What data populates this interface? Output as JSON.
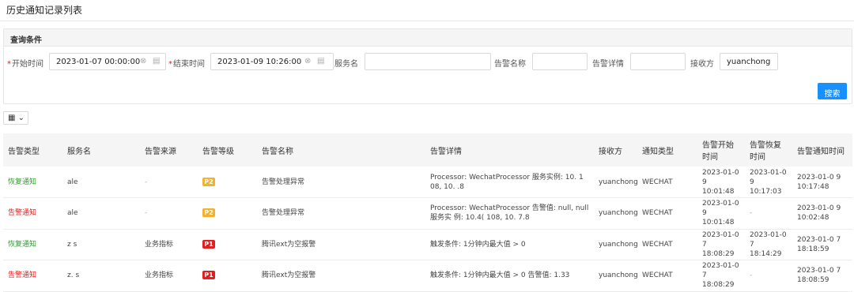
{
  "page_title": "历史通知记录列表",
  "query": {
    "panel_title": "查询条件",
    "start_label": "开始时间",
    "start_value": "2023-01-07 00:00:00",
    "end_label": "结束时间",
    "end_value": "2023-01-09 10:26:00",
    "service_label": "服务名",
    "service_value": "",
    "alarm_name_label": "告警名称",
    "alarm_name_value": "",
    "alarm_detail_label": "告警详情",
    "alarm_detail_value": "",
    "receiver_label": "接收方",
    "receiver_value": "yuanchong",
    "required_mark": "*",
    "clear_glyph": "⊗",
    "calendar_glyph": "▤",
    "search_label": "搜索"
  },
  "column_toggle_glyph": "▦ ⌄",
  "table": {
    "headers": [
      "告警类型",
      "服务名",
      "告警来源",
      "告警等级",
      "告警名称",
      "告警详情",
      "接收方",
      "通知类型",
      "告警开始时间",
      "告警恢复时间",
      "告警通知时间"
    ],
    "rows": [
      {
        "type": "恢复通知",
        "service": "ale",
        "source": "-",
        "level": "P2",
        "name": "告警处理异常",
        "detail": "Processor: WechatProcessor 服务实例: 10.        1 08, 10.       .8",
        "receiver": "yuanchong",
        "notify": "WECHAT",
        "start": "2023-01-0 9 10:01:48",
        "recover": "2023-01-0 9 10:17:03",
        "notified": "2023-01-0 9 10:17:48"
      },
      {
        "type": "告警通知",
        "service": "ale",
        "source": "-",
        "level": "P2",
        "name": "告警处理异常",
        "detail": "Processor: WechatProcessor 告警值: null, null 服务实 例: 10.4(   108, 10.      7.8",
        "receiver": "yuanchong",
        "notify": "WECHAT",
        "start": "2023-01-0 9 10:01:48",
        "recover": "-",
        "notified": "2023-01-0 9 10:02:48"
      },
      {
        "type": "恢复通知",
        "service": "z   s",
        "source": "业务指标",
        "level": "P1",
        "name": "腾讯ext为空报警",
        "detail": "触发条件: 1分钟内最大值 > 0",
        "receiver": "yuanchong",
        "notify": "WECHAT",
        "start": "2023-01-0 7 18:08:29",
        "recover": "2023-01-0 7 18:14:29",
        "notified": "2023-01-0 7 18:18:59"
      },
      {
        "type": "告警通知",
        "service": "z.   s",
        "source": "业务指标",
        "level": "P1",
        "name": "腾讯ext为空报警",
        "detail": "触发条件: 1分钟内最大值 > 0 告警值: 1.33",
        "receiver": "yuanchong",
        "notify": "WECHAT",
        "start": "2023-01-0 7 18:08:29",
        "recover": "-",
        "notified": "2023-01-0 7 18:08:59"
      }
    ]
  }
}
